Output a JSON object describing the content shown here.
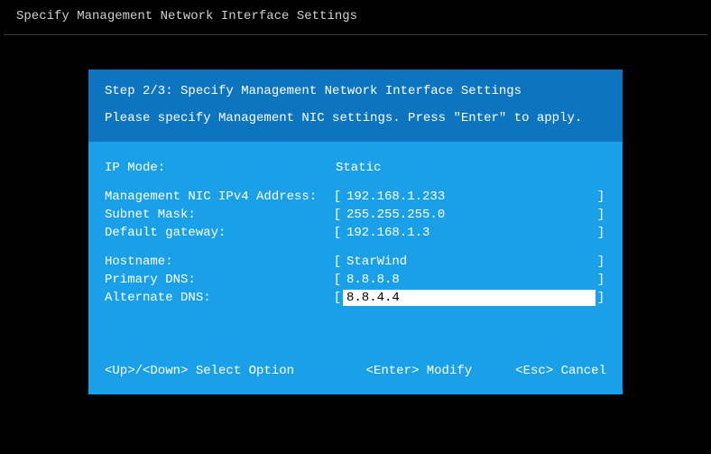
{
  "topTitle": "Specify Management Network Interface Settings",
  "header": {
    "step": "Step 2/3: Specify Management Network Interface Settings",
    "instruction": "Please specify Management NIC settings. Press \"Enter\" to apply."
  },
  "ipMode": {
    "label": "IP Mode:",
    "value": "Static"
  },
  "fields": [
    {
      "label": "Management NIC IPv4 Address:",
      "value": "192.168.1.233",
      "bracketed": true,
      "active": false
    },
    {
      "label": "Subnet Mask:",
      "value": "255.255.255.0",
      "bracketed": true,
      "active": false
    },
    {
      "label": "Default gateway:",
      "value": "192.168.1.3",
      "bracketed": true,
      "active": false
    }
  ],
  "fields2": [
    {
      "label": "Hostname:",
      "value": "StarWind",
      "bracketed": true,
      "active": false
    },
    {
      "label": "Primary DNS:",
      "value": "8.8.8.8",
      "bracketed": true,
      "active": false
    },
    {
      "label": "Alternate DNS:",
      "value": "8.8.4.4",
      "bracketed": true,
      "active": true
    }
  ],
  "footer": {
    "left": "<Up>/<Down> Select Option",
    "mid": "<Enter> Modify",
    "right": "<Esc> Cancel"
  }
}
